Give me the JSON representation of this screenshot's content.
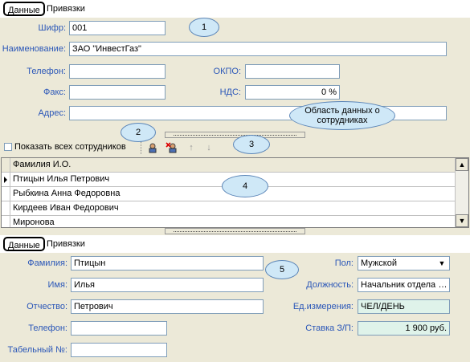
{
  "top_tabs": {
    "data": "Данные",
    "links": "Привязки"
  },
  "company_form": {
    "code_label": "Шифр:",
    "code_value": "001",
    "name_label": "Наименование:",
    "name_value": "ЗАО \"ИнвестГаз\"",
    "phone_label": "Телефон:",
    "phone_value": "",
    "okpo_label": "ОКПО:",
    "okpo_value": "",
    "fax_label": "Факс:",
    "fax_value": "",
    "vat_label": "НДС:",
    "vat_value": "0 %",
    "address_label": "Адрес:",
    "address_value": ""
  },
  "callouts": {
    "c1": "1",
    "c2": "2",
    "c3": "3",
    "c4": "4",
    "c5": "5",
    "employees_area": "Область данных о сотрудниках"
  },
  "toolbar": {
    "show_all_label": "Показать всех сотрудников",
    "show_all_checked": false
  },
  "employees_grid": {
    "header": "Фамилия И.О.",
    "rows": [
      "Птицын Илья Петрович",
      "Рыбкина Анна Федоровна",
      "Кирдеев Иван Федорович",
      "Миронова"
    ],
    "selected_index": 0
  },
  "bottom_tabs": {
    "data": "Данные",
    "links": "Привязки"
  },
  "employee_form": {
    "last_name_label": "Фамилия:",
    "last_name_value": "Птицын",
    "first_name_label": "Имя:",
    "first_name_value": "Илья",
    "patronymic_label": "Отчество:",
    "patronymic_value": "Петрович",
    "phone_label": "Телефон:",
    "phone_value": "",
    "personnel_no_label": "Табельный №:",
    "personnel_no_value": "",
    "sex_label": "Пол:",
    "sex_value": "Мужской",
    "position_label": "Должность:",
    "position_value": "Начальник отдела",
    "unit_label": "Ед.измерения:",
    "unit_value": "ЧЕЛ/ДЕНЬ",
    "rate_label": "Ставка З/П:",
    "rate_value": "1 900 руб."
  },
  "colors": {
    "label_blue": "#2b57b8",
    "callout_fill": "#cfe8f7",
    "readonly_field": "#dff3ea"
  }
}
